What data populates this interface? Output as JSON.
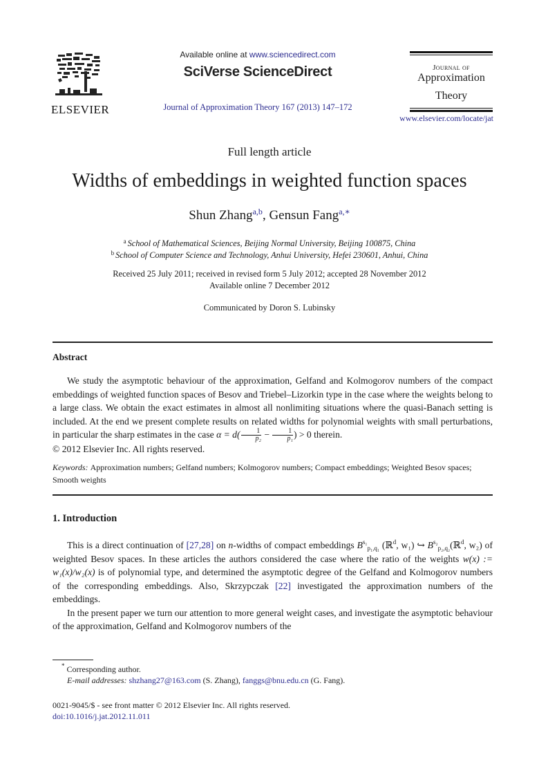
{
  "header": {
    "publisher_logo_text": "ELSEVIER",
    "available_online_prefix": "Available online at ",
    "available_online_link": "www.sciencedirect.com",
    "platform_name": "SciVerse ScienceDirect",
    "journal_citation": "Journal of Approximation Theory 167 (2013) 147–172",
    "journal_box": {
      "line1": "Journal of",
      "line2": "Approximation",
      "line3": "Theory"
    },
    "journal_url": "www.elsevier.com/locate/jat"
  },
  "article": {
    "type": "Full length article",
    "title": "Widths of embeddings in weighted function spaces",
    "authors": [
      {
        "name": "Shun Zhang",
        "affil": "a,b"
      },
      {
        "name": "Gensun Fang",
        "affil": "a,∗"
      }
    ],
    "author_separator": ", ",
    "affiliations": [
      {
        "label": "a",
        "text": "School of Mathematical Sciences, Beijing Normal University, Beijing 100875, China"
      },
      {
        "label": "b",
        "text": "School of Computer Science and Technology, Anhui University, Hefei 230601, Anhui, China"
      }
    ],
    "dates_line1": "Received 25 July 2011; received in revised form 5 July 2012; accepted 28 November 2012",
    "dates_line2": "Available online 7 December 2012",
    "communicated_by": "Communicated by Doron S. Lubinsky"
  },
  "abstract": {
    "heading": "Abstract",
    "text_part1": "We study the asymptotic behaviour of the approximation, Gelfand and Kolmogorov numbers of the compact embeddings of weighted function spaces of Besov and Triebel–Lizorkin type in the case where the weights belong to a large class. We obtain the exact estimates in almost all nonlimiting situations where the quasi-Banach setting is included. At the end we present complete results on related widths for polynomial weights with small perturbations, in particular the sharp estimates in the case ",
    "formula_alpha": "α = d(",
    "frac1_num": "1",
    "frac1_den": "p₂",
    "minus": " − ",
    "frac2_num": "1",
    "frac2_den": "p₁",
    "formula_tail": ") > 0",
    "text_part2": " therein.",
    "copyright": "© 2012 Elsevier Inc. All rights reserved."
  },
  "keywords": {
    "label": "Keywords:",
    "text": "Approximation numbers; Gelfand numbers; Kolmogorov numbers; Compact embeddings; Weighted Besov spaces; Smooth weights"
  },
  "introduction": {
    "heading": "1. Introduction",
    "p1_a": "This is a direct continuation of ",
    "p1_ref1": "[27,28]",
    "p1_b": " on ",
    "p1_n": "n",
    "p1_c": "-widths of compact embeddings ",
    "p1_B1": "B",
    "p1_B1_sup": "s₁",
    "p1_B1_sub": "p₁,q₁",
    "p1_d": " (ℝ",
    "p1_d_sup": "d",
    "p1_e": ", w₁) ↪ ",
    "p1_B2": "B",
    "p1_B2_sup": "s₂",
    "p1_B2_sub": "p₂,q₂",
    "p1_f": "(ℝ",
    "p1_f_sup": "d",
    "p1_g": ", w₂) of weighted Besov spaces. In these articles the authors considered the case where the ratio of the weights ",
    "p1_formula": "w(x) := w₁(x)/w₂(x)",
    "p1_h": " is of polynomial type, and determined the asymptotic degree of the Gelfand and Kolmogorov numbers of the corresponding embeddings. Also, Skrzypczak ",
    "p1_ref2": "[22]",
    "p1_i": " investigated the approximation numbers of the embeddings.",
    "p2": "In the present paper we turn our attention to more general weight cases, and investigate the asymptotic behaviour of the approximation, Gelfand and Kolmogorov numbers of the"
  },
  "footnotes": {
    "corresponding_mark": "*",
    "corresponding_text": " Corresponding author.",
    "email_label": "E-mail addresses:",
    "email1": "shzhang27@163.com",
    "email1_owner": " (S. Zhang), ",
    "email2": "fanggs@bnu.edu.cn",
    "email2_owner": " (G. Fang).",
    "front_matter": "0021-9045/$ - see front matter © 2012 Elsevier Inc. All rights reserved.",
    "doi": "doi:10.1016/j.jat.2012.11.011"
  },
  "colors": {
    "link": "#2b2b8f",
    "text": "#1a1a1a"
  }
}
